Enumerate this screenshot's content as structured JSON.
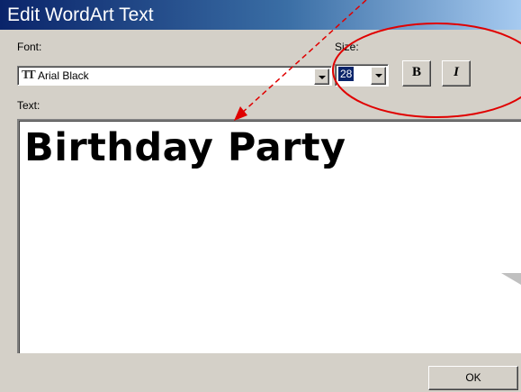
{
  "dialog": {
    "title": "Edit WordArt Text"
  },
  "font": {
    "label": "Font:",
    "value": "Arial Black",
    "icon": "truetype-font-icon"
  },
  "size": {
    "label": "Size:",
    "value": "28"
  },
  "style_buttons": {
    "bold": "B",
    "italic": "I"
  },
  "text": {
    "label": "Text:",
    "value": "Birthday Party"
  },
  "actions": {
    "ok": "OK"
  },
  "annotations": {
    "arrow_color": "#e00000",
    "ellipse_color": "#e00000"
  }
}
